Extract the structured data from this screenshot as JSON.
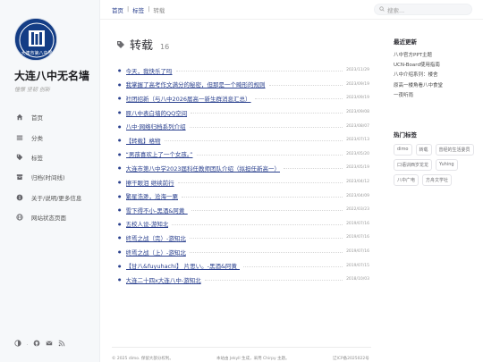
{
  "sidebar": {
    "site_title": "大连八中无名墙",
    "site_subtitle": "憧憬 坚韧 创新",
    "avatar_text": "大連市第八中學",
    "nav": [
      {
        "icon": "home-icon",
        "label": "首页"
      },
      {
        "icon": "categories-icon",
        "label": "分类"
      },
      {
        "icon": "tags-icon",
        "label": "标签"
      },
      {
        "icon": "archive-icon",
        "label": "归档(时间线)"
      },
      {
        "icon": "info-icon",
        "label": "关于/说明/更多信息"
      },
      {
        "icon": "globe-icon",
        "label": "网站状态页面"
      }
    ]
  },
  "breadcrumb": [
    "首页",
    "标签",
    "转载"
  ],
  "search": {
    "placeholder": "搜索..."
  },
  "tag_page": {
    "name": "转载",
    "count": "16"
  },
  "posts": [
    {
      "title": "今天，我快乐了吗",
      "date": "2023/11/29"
    },
    {
      "title": "我掌握了高考作文满分的秘密，但那是一个畸形的规则",
      "date": "2023/09/19"
    },
    {
      "title": "社团招新（与八中2026届高一新生群消息汇总）",
      "date": "2023/09/19"
    },
    {
      "title": "原八中表白墙的QQ空间",
      "date": "2023/09/08"
    },
    {
      "title": "八中·网络归档系列介绍",
      "date": "2023/08/07"
    },
    {
      "title": "【转载】格物",
      "date": "2023/07/13"
    },
    {
      "title": "“男孩喜欢上了一个女孩。”",
      "date": "2023/05/20"
    },
    {
      "title": "大连市第八中学2023届科任教师团队介绍（拟担任新高一）",
      "date": "2023/05/19"
    },
    {
      "title": "擦干眼泪 继续前行",
      "date": "2023/04/12"
    },
    {
      "title": "繁星浩渺，沧海一粟",
      "date": "2023/04/09"
    },
    {
      "title": "雪下得不小-黑酒&阿黄_",
      "date": "2022/03/23"
    },
    {
      "title": "五校人设-游知北",
      "date": "2019/07/16"
    },
    {
      "title": "终焉之战（完）-游知北",
      "date": "2019/07/16"
    },
    {
      "title": "终焉之战（上）-游知北",
      "date": "2019/07/16"
    },
    {
      "title": "【甘八&fuyuhachi】 片思い。-黑酒&阿黄_",
      "date": "2019/07/15"
    },
    {
      "title": "大连二十四x大连八中-游知北",
      "date": "2018/10/03"
    }
  ],
  "recent_updates": {
    "title": "最近更新",
    "items": [
      "八中官方PPT主题",
      "UCN-Board使用指南",
      "八中介绍系列：楼舍",
      "原高一楼角看八中食堂",
      "一夜听雨"
    ]
  },
  "trending_tags": {
    "title": "热门标签",
    "items": [
      "dimo",
      "转载",
      "曾经的生活委员",
      "口语训西岁龙龙",
      "Yuhing",
      "八中广电",
      "方舟文学社"
    ]
  },
  "footer": {
    "copyright": "© 2025 dimo. 保留大部分权利。",
    "powered": "本站由 Jekyll 生成，采用 Chirpy 主题。",
    "icp": "辽ICP备2025022号"
  },
  "colors": {
    "link": "#2a408e",
    "sidebar_bg": "#f6f8fa",
    "logo_bg": "#143d85"
  }
}
